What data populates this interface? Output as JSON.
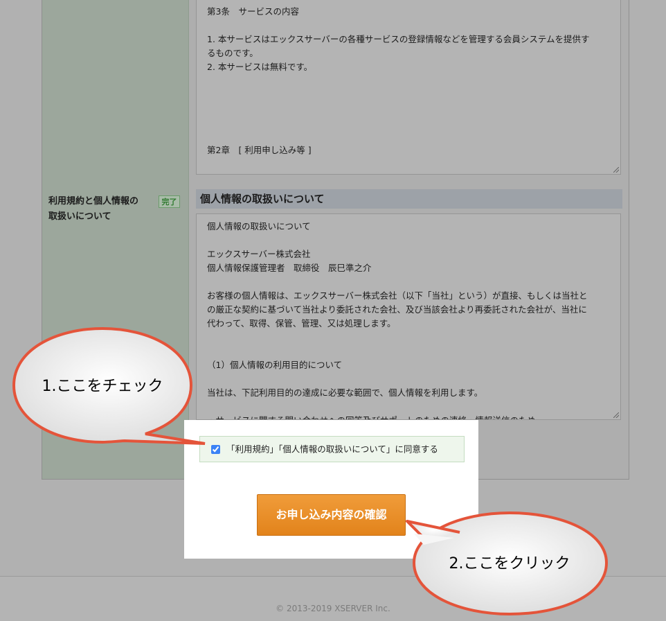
{
  "terms": {
    "lines": [
      "第3条　サービスの内容",
      "",
      "1. 本サービスはエックスサーバーの各種サービスの登録情報などを管理する会員システムを提供す",
      "るものです。",
      "2. 本サービスは無料です。",
      "",
      "",
      "",
      "",
      "",
      "第2章　[ 利用申し込み等 ]"
    ]
  },
  "privacy_section": {
    "label": "利用規約と個人情報の取扱いについて",
    "label_line1": "利用規約と個人情報の",
    "label_line2": "取扱いについて",
    "status_badge": "完了",
    "heading": "個人情報の取扱いについて",
    "lines": [
      "個人情報の取扱いについて",
      "",
      "エックスサーバー株式会社",
      "個人情報保護管理者　取締役　辰巳準之介",
      "",
      "お客様の個人情報は、エックスサーバー株式会社（以下「当社」という）が直接、もしくは当社と",
      "の厳正な契約に基づいて当社より委託された会社、及び当該会社より再委託された会社が、当社に",
      "代わって、取得、保管、管理、又は処理します。",
      "",
      "",
      "（1）個人情報の利用目的について",
      "",
      "当社は、下記利用目的の達成に必要な範囲で、個人情報を利用します。",
      "",
      "・サービスに関する問い合わせへの回答及びサポートのための連絡・情報送信のため"
    ]
  },
  "agreement": {
    "checkbox_label": "「利用規約」「個人情報の取扱いについて」に同意する",
    "checked": true
  },
  "submit_button": {
    "label": "お申し込み内容の確認"
  },
  "callouts": {
    "step1": "1.ここをチェック",
    "step2": "2.ここをクリック"
  },
  "footer": {
    "copyright": "© 2013-2019 XSERVER Inc."
  },
  "colors": {
    "accent_orange": "#e2831b",
    "callout_red": "#e4543a",
    "agree_bg": "#eef6ec"
  }
}
